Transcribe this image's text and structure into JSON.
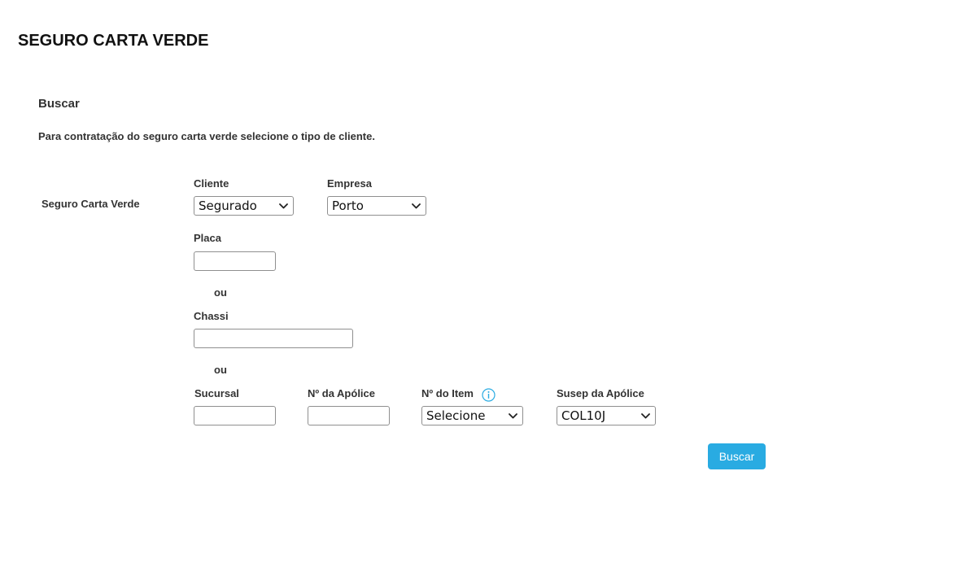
{
  "page": {
    "title": "SEGURO CARTA VERDE",
    "section_title": "Buscar",
    "instructions": "Para contratação do seguro carta verde selecione o tipo de cliente."
  },
  "form": {
    "row_label": "Seguro Carta Verde",
    "cliente": {
      "label": "Cliente",
      "value": "Segurado"
    },
    "empresa": {
      "label": "Empresa",
      "value": "Porto"
    },
    "placa": {
      "label": "Placa",
      "value": ""
    },
    "or_1": "ou",
    "chassi": {
      "label": "Chassi",
      "value": ""
    },
    "or_2": "ou",
    "sucursal": {
      "label": "Sucursal",
      "value": ""
    },
    "apolice": {
      "label": "Nº da Apólice",
      "value": ""
    },
    "item": {
      "label": "Nº do Item",
      "value": "Selecione",
      "icon": "info-icon"
    },
    "susep": {
      "label": "Susep da Apólice",
      "value": "COL10J"
    },
    "search_button": "Buscar"
  },
  "colors": {
    "button_bg": "#29abe2",
    "info_icon": "#29abe2",
    "text": "#333333"
  }
}
